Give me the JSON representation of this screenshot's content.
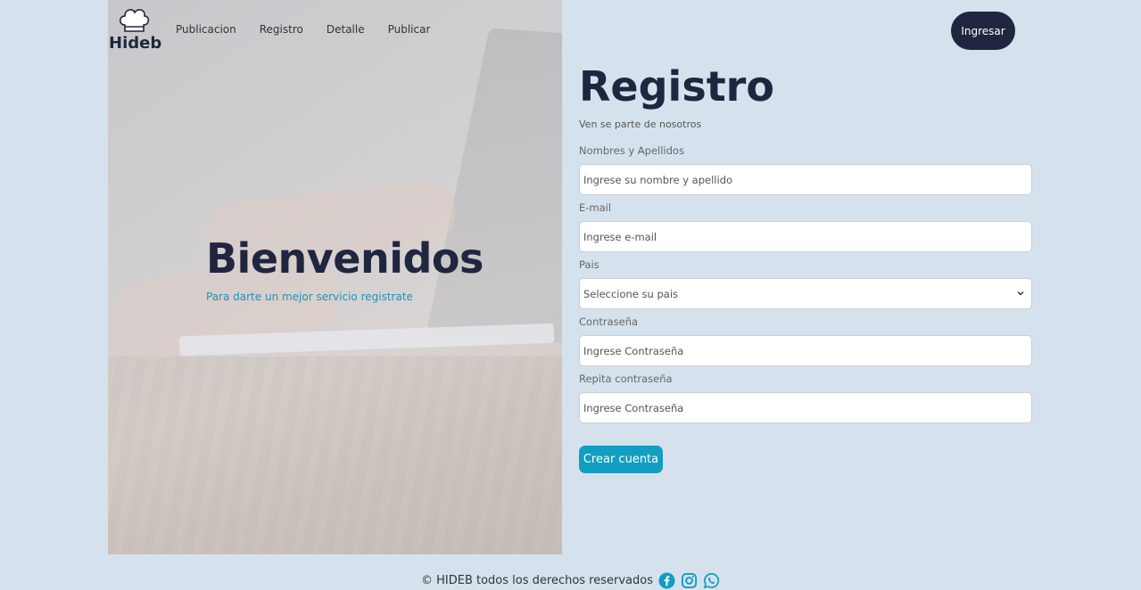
{
  "brand": {
    "name": "Hideb"
  },
  "nav": {
    "items": [
      "Publicacion",
      "Registro",
      "Detalle",
      "Publicar"
    ],
    "login_button": "Ingresar"
  },
  "hero": {
    "title": "Bienvenidos",
    "subtitle": "Para darte un mejor servicio registrate"
  },
  "form": {
    "title": "Registro",
    "subtitle": "Ven se parte de nosotros",
    "fields": [
      {
        "label": "Nombres y Apellidos",
        "placeholder": "Ingrese su nombre y apellido"
      },
      {
        "label": "E-mail",
        "placeholder": "Ingrese e-mail"
      },
      {
        "label": "Pais",
        "placeholder": "Seleccione su pais"
      },
      {
        "label": "Contraseña",
        "placeholder": "Ingrese Contraseña"
      },
      {
        "label": "Repita contraseña",
        "placeholder": "Ingrese Contraseña"
      }
    ],
    "submit": "Crear cuenta"
  },
  "footer": {
    "text": "© HIDEB todos los derechos reservados",
    "icons": [
      "facebook-icon",
      "instagram-icon",
      "whatsapp-icon"
    ]
  },
  "colors": {
    "background": "#d5e2ee",
    "dark": "#20263f",
    "accent": "#119ec1",
    "link": "#1f94b8"
  }
}
